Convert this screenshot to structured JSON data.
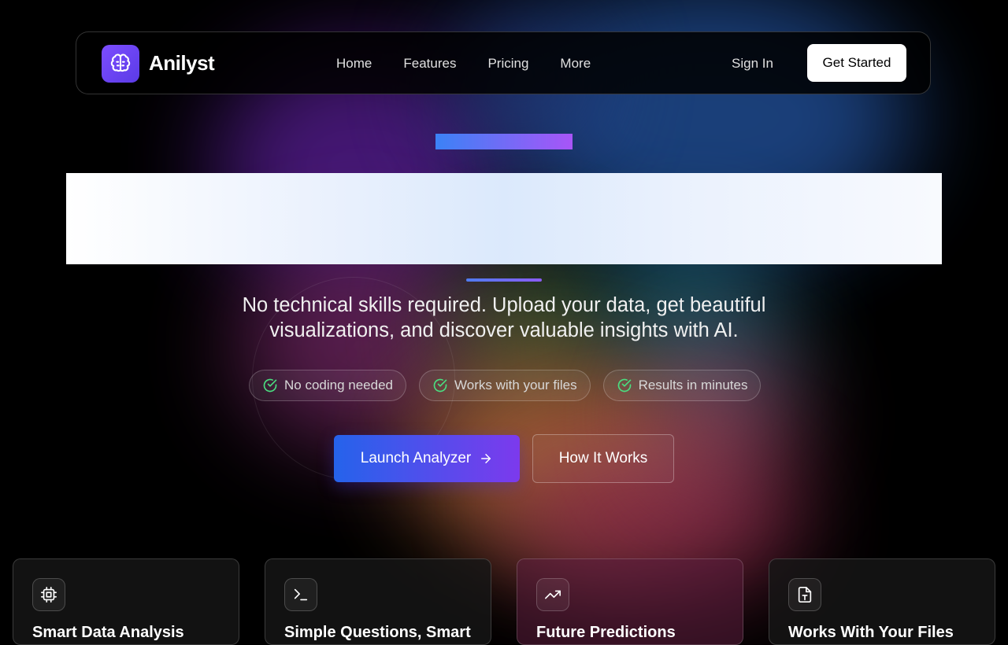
{
  "brand": {
    "name": "Anilyst",
    "logo_icon": "brain-icon",
    "logo_color": "#6d4cf0"
  },
  "nav": {
    "links": [
      "Home",
      "Features",
      "Pricing",
      "More"
    ],
    "sign_in": "Sign In",
    "get_started": "Get Started"
  },
  "hero": {
    "accent_gradient": [
      "#3b82f6",
      "#a855f7"
    ],
    "subtitle": "No technical skills required. Upload your data, get beautiful visualizations, and discover valuable insights with AI.",
    "badges": [
      {
        "icon": "check-circle-icon",
        "label": "No coding needed"
      },
      {
        "icon": "check-circle-icon",
        "label": "Works with your files"
      },
      {
        "icon": "check-circle-icon",
        "label": "Results in minutes"
      }
    ],
    "primary_cta": "Launch Analyzer",
    "secondary_cta": "How It Works"
  },
  "features": [
    {
      "icon": "cpu-icon",
      "title": "Smart Data Analysis"
    },
    {
      "icon": "terminal-icon",
      "title": "Simple Questions, Smart"
    },
    {
      "icon": "trending-up-icon",
      "title": "Future Predictions"
    },
    {
      "icon": "file-text-icon",
      "title": "Works With Your Files"
    }
  ]
}
